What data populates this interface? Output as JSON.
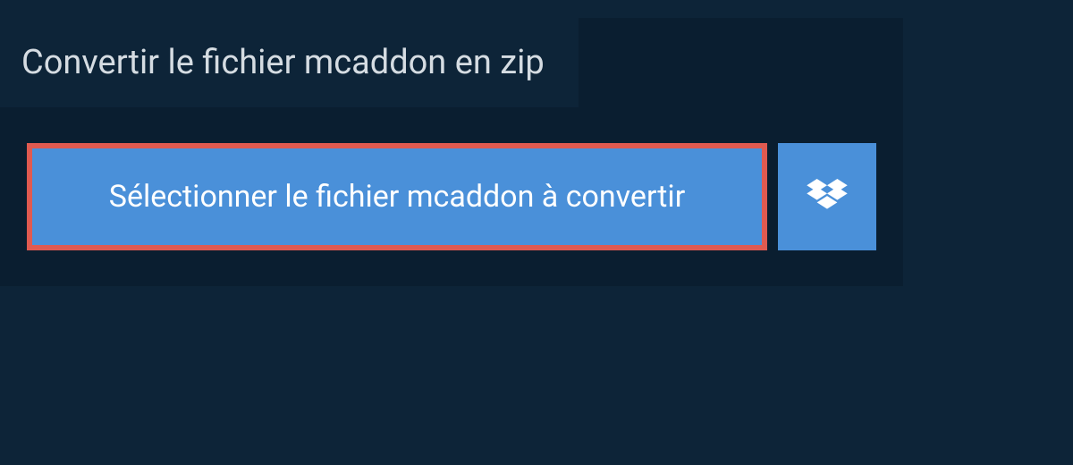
{
  "title": "Convertir le fichier mcaddon en zip",
  "buttons": {
    "select_label": "Sélectionner le fichier mcaddon à convertir"
  },
  "colors": {
    "background": "#0d2438",
    "panel": "#0a1e30",
    "button": "#4a90d9",
    "highlight_border": "#e05a50",
    "title_text": "#d5dce2",
    "button_text": "#ffffff"
  }
}
